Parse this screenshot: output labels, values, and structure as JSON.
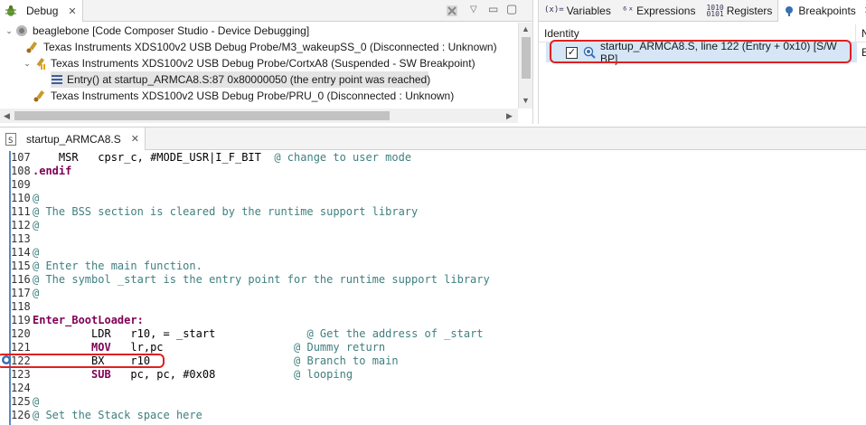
{
  "debug_view": {
    "tab_label": "Debug",
    "tree": [
      {
        "label": "beaglebone [Code Composer Studio - Device Debugging]"
      },
      {
        "label": "Texas Instruments XDS100v2 USB Debug Probe/M3_wakeupSS_0 (Disconnected : Unknown)"
      },
      {
        "label": "Texas Instruments XDS100v2 USB Debug Probe/CortxA8 (Suspended - SW Breakpoint)"
      },
      {
        "label": "Entry() at startup_ARMCA8.S:87 0x80000050  (the entry point was reached)"
      },
      {
        "label": "Texas Instruments XDS100v2 USB Debug Probe/PRU_0 (Disconnected : Unknown)"
      }
    ]
  },
  "right_tabs": {
    "variables": "Variables",
    "expressions": "Expressions",
    "registers": "Registers",
    "breakpoints": "Breakpoints"
  },
  "breakpoints_view": {
    "column_identity": "Identity",
    "column_next": "N",
    "row_label": "startup_ARMCA8.S, line 122 (Entry + 0x10)  [S/W BP]",
    "row_overflow": "E",
    "row_checked": true
  },
  "editor": {
    "tab_label": "startup_ARMCA8.S",
    "lines": [
      {
        "n": "107",
        "indent": "    ",
        "kw": "MSR",
        "kw_style": "plain",
        "operands": "   cpsr_c, #MODE_USR|I_F_BIT  ",
        "comment": "@ change to user mode"
      },
      {
        "n": "108",
        "dir": ".endif"
      },
      {
        "n": "109"
      },
      {
        "n": "110",
        "comment": "@"
      },
      {
        "n": "111",
        "comment": "@ The BSS section is cleared by the runtime support library"
      },
      {
        "n": "112",
        "comment": "@"
      },
      {
        "n": "113"
      },
      {
        "n": "114",
        "comment": "@"
      },
      {
        "n": "115",
        "comment": "@ Enter the main function."
      },
      {
        "n": "116",
        "comment": "@ The symbol _start is the entry point for the runtime support library"
      },
      {
        "n": "117",
        "comment": "@"
      },
      {
        "n": "118"
      },
      {
        "n": "119",
        "label": "Enter_BootLoader:"
      },
      {
        "n": "120",
        "indent": "         ",
        "kw": "LDR",
        "kw_style": "plain",
        "operands": "   r10, = _start              ",
        "comment": "@ Get the address of _start"
      },
      {
        "n": "121",
        "indent": "         ",
        "kw": "MOV",
        "kw_style": "kw",
        "operands": "   lr,pc                    ",
        "comment": "@ Dummy return"
      },
      {
        "n": "122",
        "indent": "         ",
        "kw": "BX",
        "kw_style": "plain",
        "operands": "    r10                      ",
        "comment": "@ Branch to main"
      },
      {
        "n": "123",
        "indent": "         ",
        "kw": "SUB",
        "kw_style": "kw",
        "operands": "   pc, pc, #0x08            ",
        "comment": "@ looping"
      },
      {
        "n": "124"
      },
      {
        "n": "125",
        "comment": "@"
      },
      {
        "n": "126",
        "comment": "@ Set the Stack space here"
      }
    ]
  },
  "colors": {
    "highlight_red": "#e02020",
    "ruler_blue": "#5b86c6",
    "selection_blue": "#d6e6f7"
  }
}
